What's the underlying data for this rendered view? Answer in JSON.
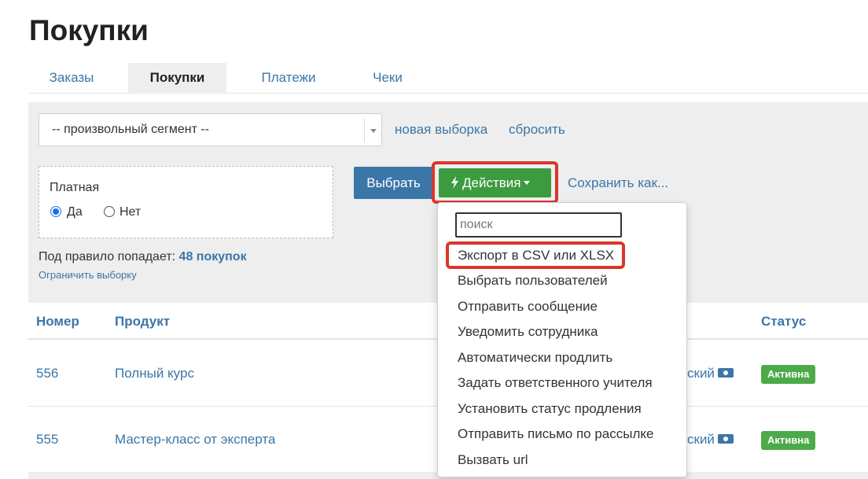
{
  "page": {
    "title": "Покупки"
  },
  "tabs": [
    {
      "label": "Заказы",
      "active": false
    },
    {
      "label": "Покупки",
      "active": true
    },
    {
      "label": "Платежи",
      "active": false
    },
    {
      "label": "Чеки",
      "active": false
    }
  ],
  "filters": {
    "segment_value": "-- произвольный сегмент --",
    "new_selection_link": "новая выборка",
    "reset_link": "сбросить",
    "criteria": {
      "label": "Платная",
      "options": [
        {
          "label": "Да",
          "checked": true
        },
        {
          "label": "Нет",
          "checked": false
        }
      ]
    },
    "rule_prefix": "Под правило попадает:",
    "rule_count": "48 покупок",
    "limit_link": "Ограничить выборку"
  },
  "toolbar": {
    "select_label": "Выбрать",
    "actions_label": "Действия",
    "save_as_label": "Сохранить как..."
  },
  "actions_menu": {
    "search_placeholder": "поиск",
    "items": [
      "Экспорт в CSV или XLSX",
      "Выбрать пользователей",
      "Отправить сообщение",
      "Уведомить сотрудника",
      "Автоматически продлить",
      "Задать ответственного учителя",
      "Установить статус продления",
      "Отправить письмо по рассылке",
      "Вызвать url"
    ]
  },
  "table": {
    "columns": {
      "number": "Номер",
      "product": "Продукт",
      "status": "Статус"
    },
    "rows": [
      {
        "number": "556",
        "product": "Полный курс",
        "partial": "ский",
        "status": "Активна"
      },
      {
        "number": "555",
        "product": "Мастер-класс от эксперта",
        "partial": "ский",
        "status": "Активна"
      }
    ]
  },
  "colors": {
    "accent_blue": "#3b76a8",
    "actions_green": "#3d9b3f",
    "highlight_red": "#d9372b",
    "badge_green": "#4caa48",
    "panel_gray": "#eeeeee"
  },
  "icons": [
    "bolt-icon",
    "caret-down-icon",
    "cash-icon",
    "select-arrow-icon"
  ]
}
